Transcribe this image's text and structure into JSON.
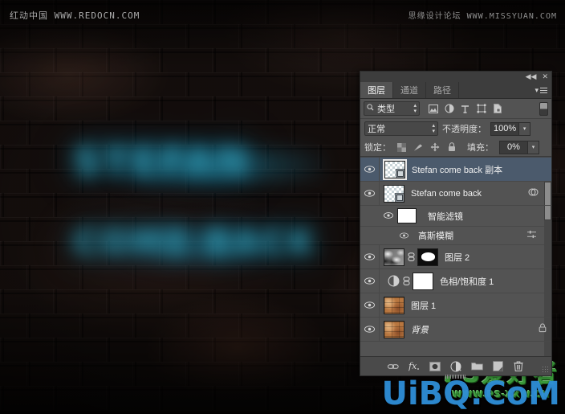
{
  "watermarks": {
    "top_left": "红动中国 WWW.REDOCN.COM",
    "top_right": "思缘设计论坛 WWW.MISSYUAN.COM",
    "bottom_green": "PS爱好者",
    "bottom_green_sub": "WWW.PS-XXW.CN",
    "bottom_blue": "UiBQ.CoM"
  },
  "canvas": {
    "glow_line1": "STEFAN",
    "glow_line2": "COME BACK",
    "glow_color": "#2a8fae",
    "wall_color": "#17100e"
  },
  "panel": {
    "titlebar": {
      "collapse_label": "◀◀",
      "close_label": "✕"
    },
    "tabs": [
      {
        "label": "图层",
        "active": true
      },
      {
        "label": "通道",
        "active": false
      },
      {
        "label": "路径",
        "active": false
      }
    ],
    "menu_label": "≡",
    "filter": {
      "kind_label": "类型",
      "icons": [
        "pixel-layer-icon",
        "adjustment-layer-icon",
        "type-layer-icon",
        "shape-layer-icon",
        "smart-object-icon"
      ],
      "toggle_name": "filter-toggle"
    },
    "blend": {
      "mode": "正常",
      "opacity_label": "不透明度：",
      "opacity_value": "100%"
    },
    "lock": {
      "label": "锁定：",
      "icons": [
        "lock-transparent-pixels-icon",
        "lock-image-pixels-icon",
        "lock-position-icon",
        "lock-all-icon"
      ],
      "fill_label": "填充：",
      "fill_value": "0%"
    },
    "layers": [
      {
        "name": "Stefan  come back 副本",
        "type": "smart-object",
        "visible": true,
        "selected": true,
        "thumb": "checker",
        "italic": false
      },
      {
        "name": "Stefan  come back",
        "type": "smart-object",
        "visible": true,
        "selected": false,
        "thumb": "checker",
        "italic": false,
        "end_icon": "smart-filter-icon"
      },
      {
        "name": "智能滤镜",
        "type": "smart-filter-group",
        "visible": true,
        "selected": false,
        "thumb": "white-mask",
        "indent": 1
      },
      {
        "name": "高斯模糊",
        "type": "smart-filter",
        "visible": true,
        "selected": false,
        "indent": 2,
        "end_icon": "filter-blending-options-icon"
      },
      {
        "name": "图层 2",
        "type": "pixel",
        "visible": true,
        "selected": false,
        "thumb": "cloud",
        "mask": "black-mask",
        "linked": true
      },
      {
        "name": "色相/饱和度 1",
        "type": "adjustment",
        "visible": true,
        "selected": false,
        "thumb": "hue-sat-icon",
        "mask": "white-mask",
        "linked": true
      },
      {
        "name": "图层 1",
        "type": "pixel",
        "visible": true,
        "selected": false,
        "thumb": "brick"
      },
      {
        "name": "背景",
        "type": "background",
        "visible": true,
        "selected": false,
        "thumb": "brick",
        "italic": true,
        "end_icon": "lock-icon"
      }
    ],
    "footer_buttons": [
      "link-layers-icon",
      "layer-style-fx-icon",
      "add-layer-mask-icon",
      "new-adjustment-layer-icon",
      "new-group-icon",
      "new-layer-icon",
      "delete-layer-icon"
    ],
    "colors": {
      "panel_bg": "#535353",
      "header_bg": "#3d3d3d",
      "selected_row": "#4b5a6c",
      "footer_bg": "#4a4a4a",
      "text": "#f0f0f0"
    }
  }
}
